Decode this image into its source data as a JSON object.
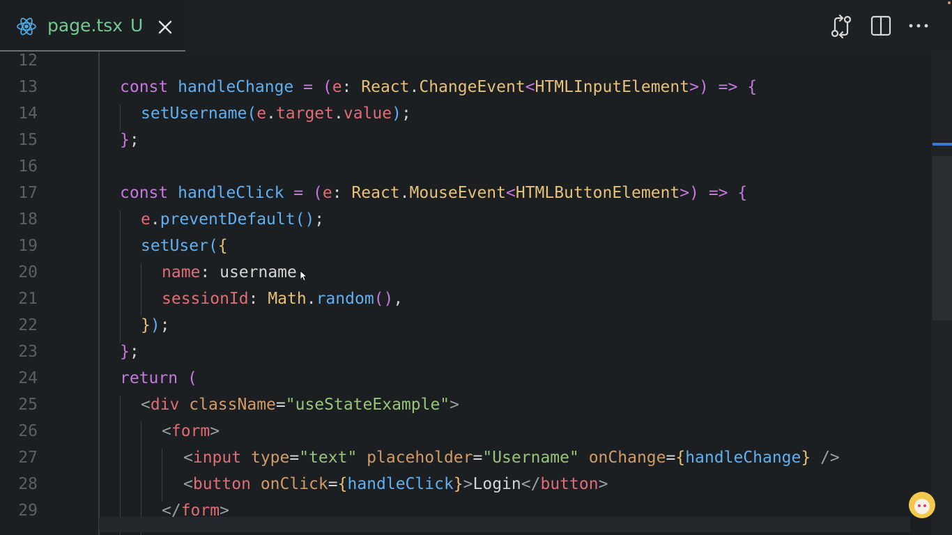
{
  "tab": {
    "title": "page.tsx",
    "badge": "U",
    "icon": "react-icon"
  },
  "toolbar": {
    "icons": [
      "compare-changes-icon",
      "split-editor-icon",
      "more-actions-icon"
    ]
  },
  "editor": {
    "line_numbers": [
      "12",
      "13",
      "14",
      "15",
      "16",
      "17",
      "18",
      "19",
      "20",
      "21",
      "22",
      "23",
      "24",
      "25",
      "26",
      "27",
      "28",
      "29"
    ],
    "lines": {
      "l13": [
        "const",
        " ",
        "handleChange",
        " = ",
        "(",
        "e",
        ": ",
        "React",
        ".",
        "ChangeEvent",
        "<",
        "HTMLInputElement",
        ">",
        ")",
        " => ",
        "{"
      ],
      "l14": [
        "setUsername",
        "(",
        "e",
        ".",
        "target",
        ".",
        "value",
        ")",
        ";"
      ],
      "l15": [
        "}",
        ";"
      ],
      "l17": [
        "const",
        " ",
        "handleClick",
        " = ",
        "(",
        "e",
        ": ",
        "React",
        ".",
        "MouseEvent",
        "<",
        "HTMLButtonElement",
        ">",
        ")",
        " => ",
        "{"
      ],
      "l18": [
        "e",
        ".",
        "preventDefault",
        "()",
        ";"
      ],
      "l19": [
        "setUser",
        "(",
        "{"
      ],
      "l20": [
        "name",
        ": ",
        "username",
        ","
      ],
      "l21": [
        "sessionId",
        ": ",
        "Math",
        ".",
        "random",
        "()",
        ","
      ],
      "l22": [
        "}",
        ")",
        ";"
      ],
      "l23": [
        "}",
        ";"
      ],
      "l24": [
        "return",
        " ",
        "("
      ],
      "l25": [
        "<",
        "div",
        " ",
        "className",
        "=",
        "\"useStateExample\"",
        ">"
      ],
      "l26": [
        "<",
        "form",
        ">"
      ],
      "l27": [
        "<",
        "input",
        " ",
        "type",
        "=",
        "\"text\"",
        " ",
        "placeholder",
        "=",
        "\"Username\"",
        " ",
        "onChange",
        "=",
        "{",
        "handleChange",
        "}",
        " />"
      ],
      "l28": [
        "<",
        "button",
        " ",
        "onClick",
        "=",
        "{",
        "handleClick",
        "}",
        ">",
        "Login",
        "</",
        "button",
        ">"
      ],
      "l29": [
        "</",
        "form",
        ">"
      ]
    }
  },
  "colors": {
    "keyword": "#c678dd",
    "function": "#61afef",
    "variable": "#e06c75",
    "type": "#e5c07b",
    "string": "#98c379",
    "attribute": "#d19a66",
    "line_number": "#5a6066",
    "tab_modified": "#73c991"
  }
}
